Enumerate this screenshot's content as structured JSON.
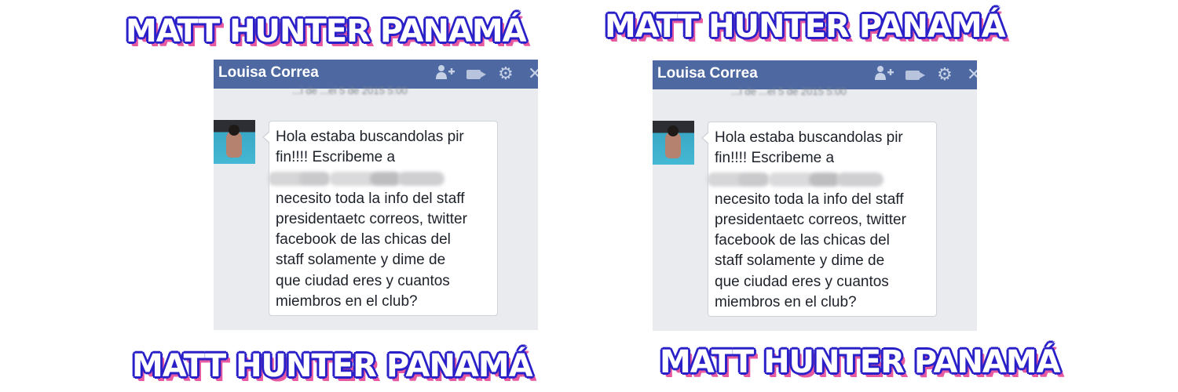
{
  "watermark": {
    "text": "MATT HUNTER PANAMÁ",
    "fill_color": "#ffffff",
    "outline_color": "#2a20c8",
    "shadow_color": "#e85aa0"
  },
  "chat_window": {
    "title": "Louisa Correa",
    "header_color": "#4e69a2",
    "background_color": "#e9ebee",
    "icons": [
      "add-friend-icon",
      "video-call-icon",
      "gear-icon",
      "close-icon"
    ],
    "timestamp_blurred": "...l de ...el 5 de 2015 5:00",
    "message_lines": [
      "Hola estaba buscandolas pir",
      "fin!!!! Escribeme a",
      "necesito toda la info del staff",
      "presidentaetc correos, twitter",
      "facebook de las chicas del",
      "staff solamente y dime de",
      "que ciudad eres y cuantos",
      "miembros en el club?"
    ]
  }
}
